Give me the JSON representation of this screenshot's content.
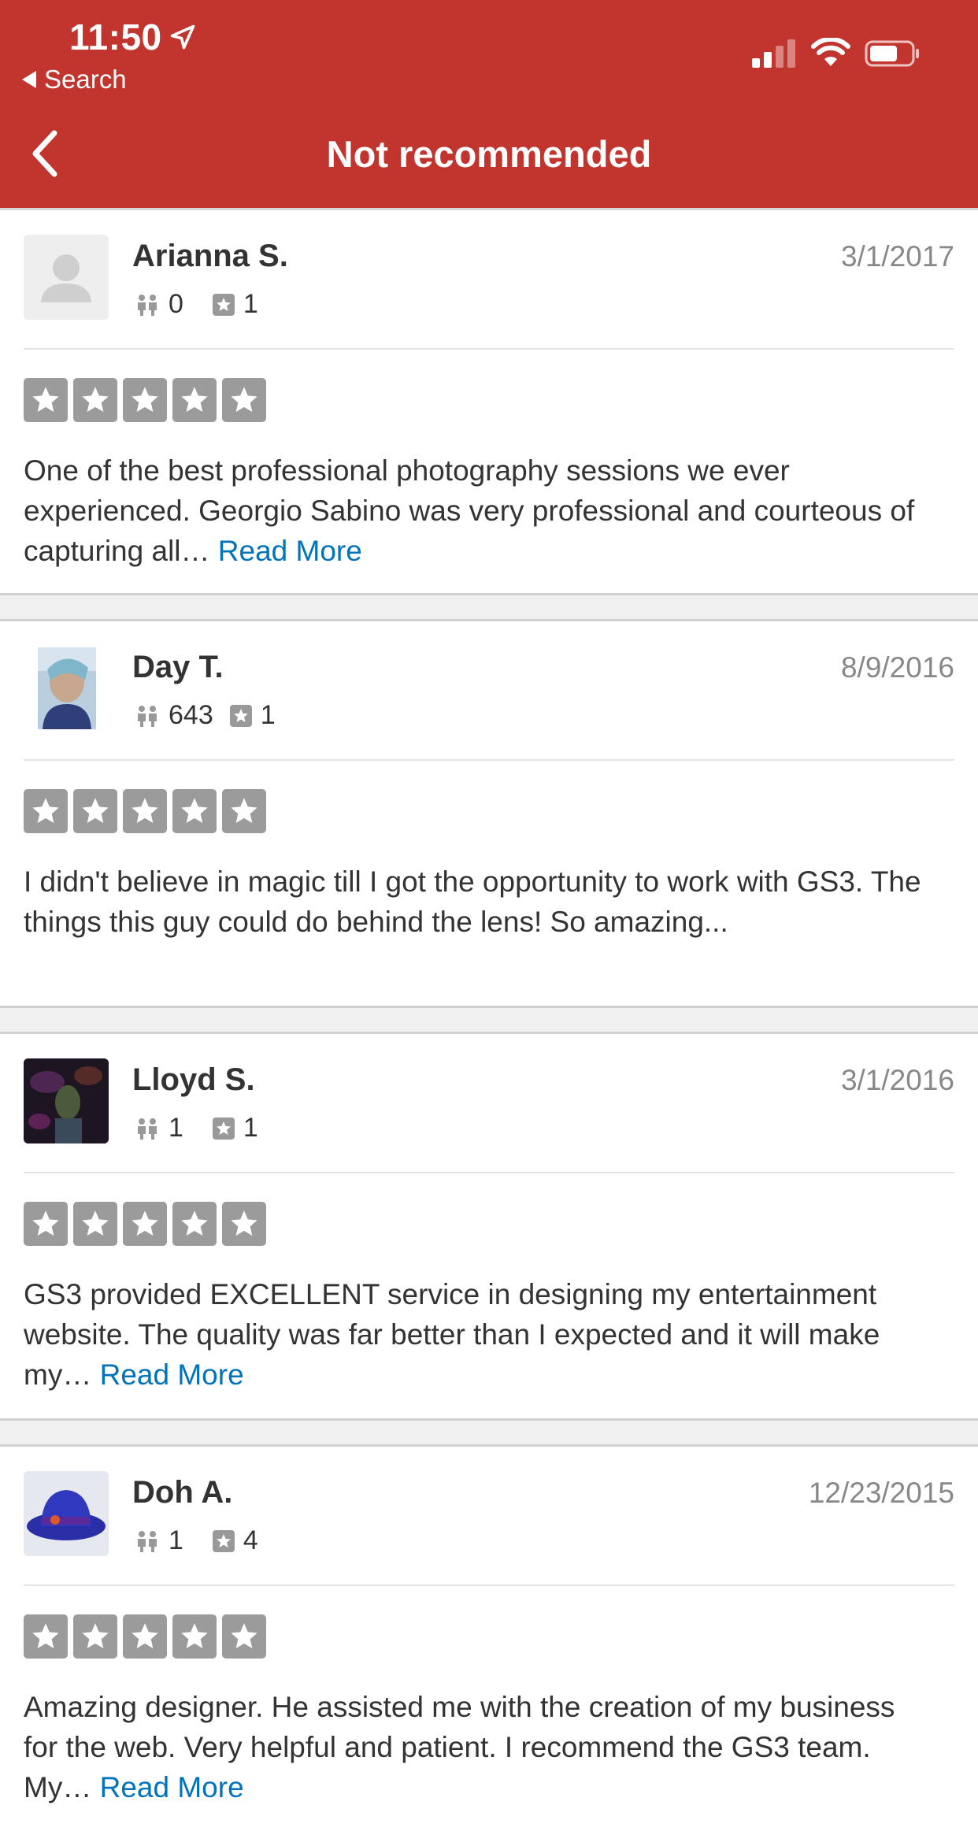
{
  "status_bar": {
    "time": "11:50",
    "back_label": "Search"
  },
  "nav": {
    "title": "Not recommended"
  },
  "colors": {
    "brand": "#c2352e",
    "link": "#0073bb",
    "star_empty": "#9b9b9b"
  },
  "reviews": [
    {
      "name": "Arianna S.",
      "date": "3/1/2017",
      "friends": "0",
      "reviews": "1",
      "rating": 0,
      "text": "One of the best professional photography sessions we ever experienced. Georgio Sabino was very professional and courteous of capturing all…",
      "read_more": "Read More"
    },
    {
      "name": "Day T.",
      "date": "8/9/2016",
      "friends": "643",
      "reviews": "1",
      "rating": 0,
      "text": "I didn't believe in magic till I got the opportunity to work with GS3. The things this guy could do behind the lens! So amazing...",
      "read_more": ""
    },
    {
      "name": "Lloyd S.",
      "date": "3/1/2016",
      "friends": "1",
      "reviews": "1",
      "rating": 0,
      "text": "GS3 provided EXCELLENT service in designing my entertainment website. The quality was far better than I expected and it will make my…",
      "read_more": "Read More"
    },
    {
      "name": "Doh A.",
      "date": "12/23/2015",
      "friends": "1",
      "reviews": "4",
      "rating": 0,
      "text": "Amazing designer. He assisted me with the creation of my business for the web. Very helpful and patient. I recommend the GS3 team. My…",
      "read_more": "Read More"
    }
  ]
}
